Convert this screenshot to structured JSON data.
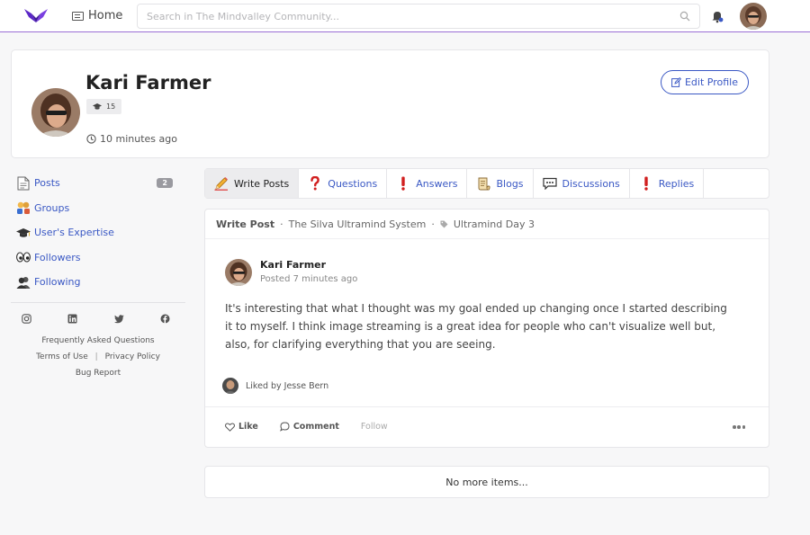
{
  "header": {
    "home_label": "Home",
    "search_placeholder": "Search in The Mindvalley Community..."
  },
  "profile": {
    "name": "Kari Farmer",
    "level": "15",
    "last_active": "10 minutes ago",
    "edit_label": "Edit Profile"
  },
  "sidebar": {
    "items": [
      {
        "label": "Posts",
        "icon": "document-icon",
        "count": "2"
      },
      {
        "label": "Groups",
        "icon": "groups-icon"
      },
      {
        "label": "User's Expertise",
        "icon": "graduation-cap-icon"
      },
      {
        "label": "Followers",
        "icon": "eyes-icon"
      },
      {
        "label": "Following",
        "icon": "people-icon"
      }
    ],
    "footer": {
      "faq": "Frequently Asked Questions",
      "terms": "Terms of Use",
      "separator": "|",
      "privacy": "Privacy Policy",
      "bug": "Bug Report"
    }
  },
  "tabs": [
    {
      "label": "Write Posts",
      "icon": "pencil-icon",
      "active": true
    },
    {
      "label": "Questions",
      "icon": "question-mark-icon"
    },
    {
      "label": "Answers",
      "icon": "exclamation-icon"
    },
    {
      "label": "Blogs",
      "icon": "scroll-icon"
    },
    {
      "label": "Discussions",
      "icon": "speech-bubble-icon"
    },
    {
      "label": "Replies",
      "icon": "exclamation-icon"
    }
  ],
  "post": {
    "type": "Write Post",
    "separator": "·",
    "group": "The Silva Ultramind System",
    "topic": "Ultramind Day 3",
    "author": "Kari Farmer",
    "posted": "Posted 7 minutes ago",
    "body": "It's interesting that what I thought was my goal ended up changing once I started describing it to myself. I think image streaming is a great idea for people who can't visualize well but, also, for clarifying everything that you are seeing.",
    "liked_by": "Liked by Jesse Bern",
    "actions": {
      "like": "Like",
      "comment": "Comment",
      "follow": "Follow"
    }
  },
  "feed": {
    "end_message": "No more items..."
  },
  "colors": {
    "accent": "#3a58c4",
    "brand": "#6b2fd0",
    "topbar_border": "#9b6fd6"
  }
}
